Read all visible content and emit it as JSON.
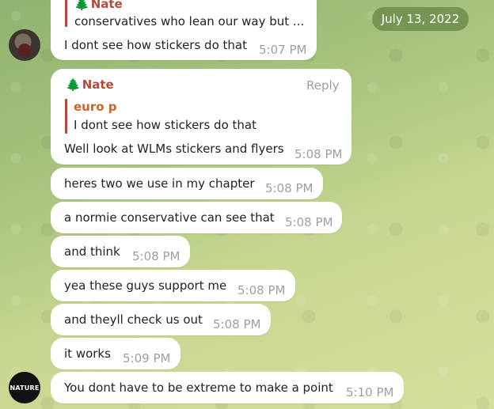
{
  "date_divider": "July 13, 2022",
  "icons": {
    "tree": "🌲"
  },
  "messages": {
    "m0": {
      "reply_name": "Nate",
      "reply_text": "conservatives who lean our way but ...",
      "text": "I dont see how stickers do that",
      "time": "5:07 PM"
    },
    "m1": {
      "sender": "Nate",
      "reply_label": "Reply",
      "quote_name": "euro p",
      "quote_text": "I dont see how stickers do that",
      "text": "Well look at WLMs stickers and flyers",
      "time": "5:08 PM"
    },
    "m2": {
      "text": "heres two we use in my chapter",
      "time": "5:08 PM"
    },
    "m3": {
      "text": "a normie conservative can see that",
      "time": "5:08 PM"
    },
    "m4": {
      "text": "and think",
      "time": "5:08 PM"
    },
    "m5": {
      "text": "yea these guys support me",
      "time": "5:08 PM"
    },
    "m6": {
      "text": "and theyll check us out",
      "time": "5:08 PM"
    },
    "m7": {
      "text": "it works",
      "time": "5:09 PM"
    },
    "m8": {
      "text": "You dont have to be extreme to make a point",
      "time": "5:10 PM"
    }
  },
  "avatars": {
    "bottom_text": "NATURE"
  }
}
